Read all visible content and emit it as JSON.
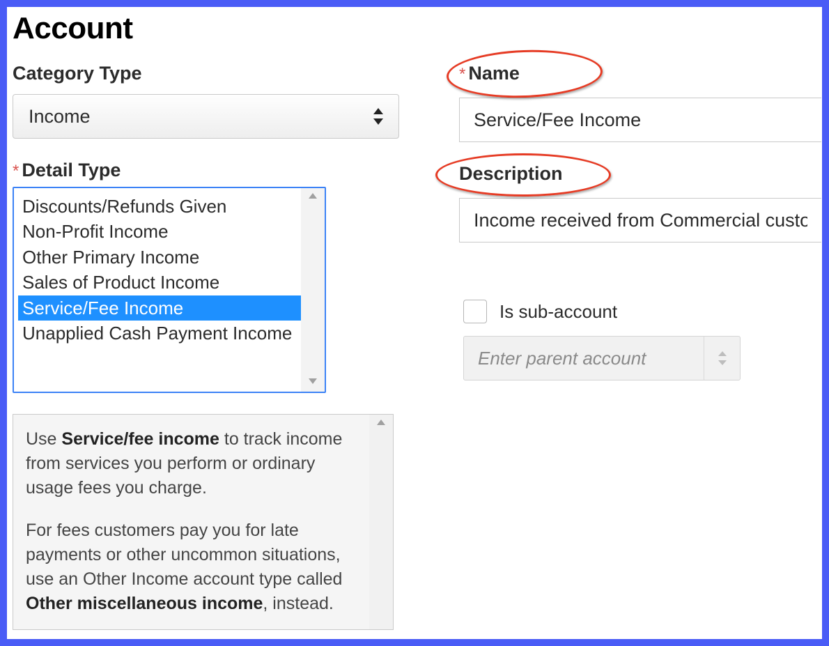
{
  "page": {
    "title": "Account"
  },
  "category": {
    "label": "Category Type",
    "value": "Income"
  },
  "detail": {
    "label": "Detail Type",
    "options": [
      "Discounts/Refunds Given",
      "Non-Profit Income",
      "Other Primary Income",
      "Sales of Product Income",
      "Service/Fee Income",
      "Unapplied Cash Payment Income"
    ],
    "selected_index": 4
  },
  "help": {
    "p1_prefix": "Use ",
    "p1_bold": "Service/fee income",
    "p1_suffix": " to track income from services you perform or ordinary usage fees you charge.",
    "p2_prefix": "For fees customers pay you for late payments or other uncommon situations, use an Other Income account type called ",
    "p2_bold": "Other miscellaneous income",
    "p2_suffix": ", instead."
  },
  "name": {
    "label": "Name",
    "value": "Service/Fee Income"
  },
  "description": {
    "label": "Description",
    "value": "Income received from Commercial custo"
  },
  "subaccount": {
    "label": "Is sub-account",
    "parent_placeholder": "Enter parent account"
  }
}
